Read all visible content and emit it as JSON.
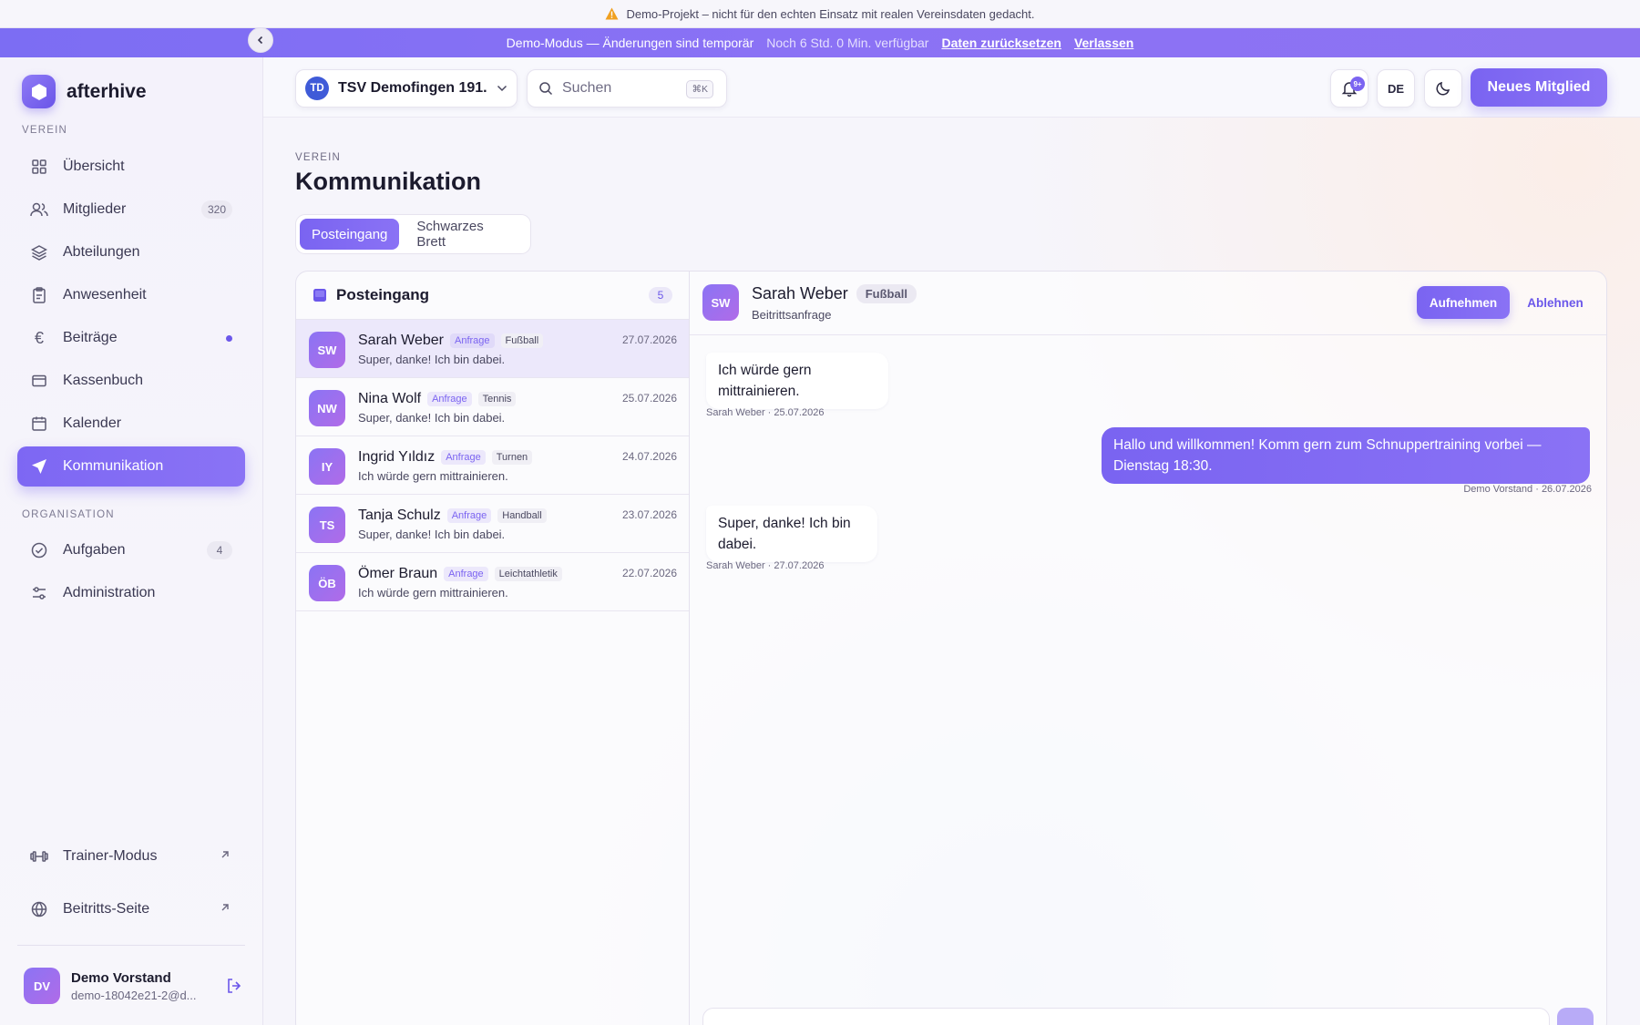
{
  "banners": {
    "warning": "Demo-Projekt – nicht für den echten Einsatz mit realen Vereinsdaten gedacht.",
    "demo_mode": "Demo-Modus — Änderungen sind temporär",
    "remaining": "Noch 6 Std. 0 Min. verfügbar",
    "reset_link": "Daten zurücksetzen",
    "leave_link": "Verlassen"
  },
  "sidebar": {
    "brand": "afterhive",
    "section_club": "VEREIN",
    "section_org": "ORGANISATION",
    "items": [
      {
        "label": "Übersicht",
        "icon": "grid-icon"
      },
      {
        "label": "Mitglieder",
        "icon": "users-icon",
        "badge": "320"
      },
      {
        "label": "Abteilungen",
        "icon": "layers-icon"
      },
      {
        "label": "Anwesenheit",
        "icon": "clipboard-icon"
      },
      {
        "label": "Beiträge",
        "icon": "euro-icon"
      },
      {
        "label": "Kassenbuch",
        "icon": "wallet-icon"
      },
      {
        "label": "Kalender",
        "icon": "calendar-icon"
      },
      {
        "label": "Kommunikation",
        "icon": "send-icon",
        "active": true
      }
    ],
    "org_items": [
      {
        "label": "Aufgaben",
        "icon": "check-circle-icon",
        "badge": "4"
      },
      {
        "label": "Administration",
        "icon": "sliders-icon"
      }
    ],
    "bottom_items": [
      {
        "label": "Trainer-Modus",
        "icon": "dumbbell-icon"
      },
      {
        "label": "Beitritts-Seite",
        "icon": "globe-icon"
      }
    ],
    "user": {
      "initials": "DV",
      "name": "Demo Vorstand",
      "email": "demo-18042e21-2@d..."
    }
  },
  "topbar": {
    "club_initials": "TD",
    "club_name": "TSV Demofingen 191...",
    "search_placeholder": "Suchen",
    "search_shortcut": "⌘K",
    "notif_badge": "9+",
    "language": "DE",
    "new_member": "Neues Mitglied"
  },
  "page": {
    "eyebrow": "VEREIN",
    "title": "Kommunikation",
    "tabs": [
      "Posteingang",
      "Schwarzes Brett"
    ]
  },
  "inbox": {
    "title": "Posteingang",
    "count": "5",
    "rows": [
      {
        "initials": "SW",
        "name": "Sarah Weber",
        "tag": "Anfrage",
        "dept": "Fußball",
        "msg": "Super, danke! Ich bin dabei.",
        "date": "27.07.2026"
      },
      {
        "initials": "NW",
        "name": "Nina Wolf",
        "tag": "Anfrage",
        "dept": "Tennis",
        "msg": "Super, danke! Ich bin dabei.",
        "date": "25.07.2026"
      },
      {
        "initials": "IY",
        "name": "Ingrid Yıldız",
        "tag": "Anfrage",
        "dept": "Turnen",
        "msg": "Ich würde gern mittrainieren.",
        "date": "24.07.2026"
      },
      {
        "initials": "TS",
        "name": "Tanja Schulz",
        "tag": "Anfrage",
        "dept": "Handball",
        "msg": "Super, danke! Ich bin dabei.",
        "date": "23.07.2026"
      },
      {
        "initials": "ÖB",
        "name": "Ömer Braun",
        "tag": "Anfrage",
        "dept": "Leichtathletik",
        "msg": "Ich würde gern mittrainieren.",
        "date": "22.07.2026"
      }
    ]
  },
  "conversation": {
    "initials": "SW",
    "name": "Sarah Weber",
    "dept": "Fußball",
    "subtitle": "Beitrittsanfrage",
    "accept": "Aufnehmen",
    "decline": "Ablehnen",
    "messages": [
      {
        "text": "Ich würde gern mittrainieren.",
        "meta": "Sarah Weber · 25.07.2026"
      },
      {
        "text": "Hallo und willkommen! Komm gern zum Schnuppertraining vorbei — Dienstag 18:30.",
        "meta": "Demo Vorstand · 26.07.2026"
      },
      {
        "text": "Super, danke! Ich bin dabei.",
        "meta": "Sarah Weber · 27.07.2026"
      }
    ]
  },
  "colors": {
    "accent": "#7b64f1",
    "banner": "#8b72f5",
    "club_avatar": "#3f5bd8"
  }
}
